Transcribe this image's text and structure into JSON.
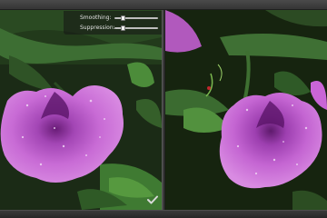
{
  "controls": {
    "smoothing": {
      "label": "Smoothing:",
      "value": 0.2
    },
    "suppression": {
      "label": "Suppression:",
      "value": 0.2
    }
  },
  "icons": {
    "confirm": "checkmark-icon"
  },
  "colors": {
    "background": "#2b2b2b",
    "panel": "#141414",
    "petal": "#c25fd0",
    "foliage": "#2e5a22"
  }
}
